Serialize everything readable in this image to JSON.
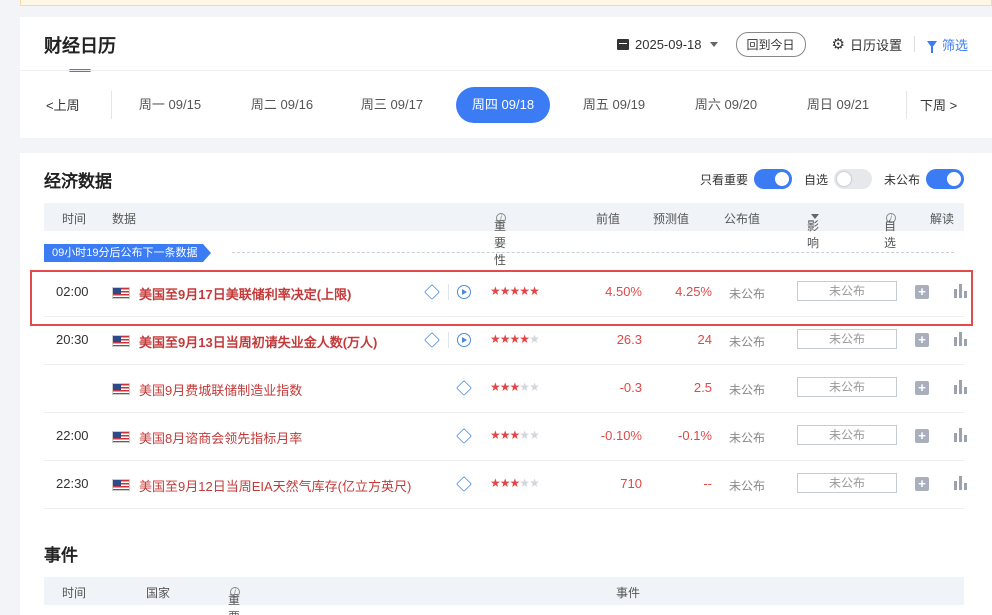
{
  "header": {
    "title": "财经日历",
    "date": "2025-09-18",
    "today_btn": "回到今日",
    "settings": "日历设置",
    "filter": "筛选"
  },
  "week": {
    "prev": "上周",
    "next": "下周",
    "days": [
      "周一 09/15",
      "周二 09/16",
      "周三 09/17",
      "周四 09/18",
      "周五 09/19",
      "周六 09/20",
      "周日 09/21"
    ],
    "active_index": 3
  },
  "econ": {
    "title": "经济数据",
    "toggles": [
      {
        "label": "只看重要",
        "on": true
      },
      {
        "label": "自选",
        "on": false
      },
      {
        "label": "未公布",
        "on": true
      }
    ],
    "columns": {
      "time": "时间",
      "data": "数据",
      "importance": "重要性",
      "prev": "前值",
      "forecast": "预测值",
      "published": "公布值",
      "impact": "影响",
      "watch": "自选",
      "analysis": "解读"
    },
    "countdown": "09小时19分后公布下一条数据",
    "rows": [
      {
        "time": "02:00",
        "name": "美国至9月17日美联储利率决定(上限)",
        "bold": true,
        "stars": 5,
        "video": true,
        "prev": "4.50%",
        "forecast": "4.25%",
        "published": "未公布",
        "impact": "未公布"
      },
      {
        "time": "20:30",
        "name": "美国至9月13日当周初请失业金人数(万人)",
        "bold": true,
        "stars": 4,
        "video": true,
        "prev": "26.3",
        "forecast": "24",
        "published": "未公布",
        "impact": "未公布"
      },
      {
        "time": "",
        "name": "美国9月费城联储制造业指数",
        "bold": false,
        "stars": 3,
        "video": false,
        "prev": "-0.3",
        "forecast": "2.5",
        "published": "未公布",
        "impact": "未公布"
      },
      {
        "time": "22:00",
        "name": "美国8月谘商会领先指标月率",
        "bold": false,
        "stars": 3,
        "video": false,
        "prev": "-0.10%",
        "forecast": "-0.1%",
        "published": "未公布",
        "impact": "未公布"
      },
      {
        "time": "22:30",
        "name": "美国至9月12日当周EIA天然气库存(亿立方英尺)",
        "bold": false,
        "stars": 3,
        "video": false,
        "prev": "710",
        "forecast": "--",
        "published": "未公布",
        "impact": "未公布"
      }
    ]
  },
  "events": {
    "title": "事件",
    "columns": {
      "time": "时间",
      "country": "国家",
      "importance": "重要性",
      "event": "事件"
    }
  },
  "colors": {
    "accent": "#3b7cf5",
    "up": "#e04848",
    "highlight": "#e34a4a"
  }
}
